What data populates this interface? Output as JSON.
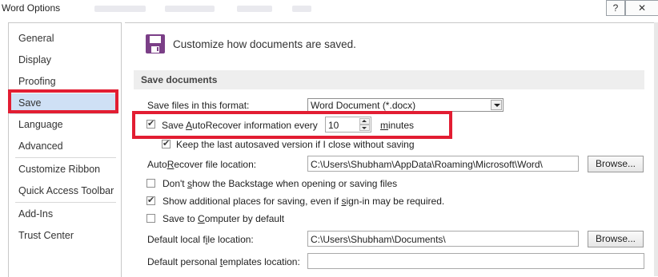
{
  "window": {
    "title": "Word Options",
    "help_label": "?",
    "close_label": "✕"
  },
  "nav": {
    "items": [
      {
        "label": "General"
      },
      {
        "label": "Display"
      },
      {
        "label": "Proofing"
      },
      {
        "label": "Save",
        "selected": true
      },
      {
        "label": "Language"
      },
      {
        "label": "Advanced"
      },
      {
        "label": "Customize Ribbon"
      },
      {
        "label": "Quick Access Toolbar"
      },
      {
        "label": "Add-Ins"
      },
      {
        "label": "Trust Center"
      }
    ]
  },
  "header": {
    "text": "Customize how documents are saved.",
    "icon": "floppy-disk-icon"
  },
  "section": {
    "title": "Save documents"
  },
  "format": {
    "label": "Save files in this format:",
    "value": "Word Document (*.docx)"
  },
  "autorecover": {
    "checked": true,
    "label_pre": "Save ",
    "label_ul": "A",
    "label_post": "utoRecover information every",
    "minutes_value": "10",
    "minutes_ul": "m",
    "minutes_post": "inutes"
  },
  "keep_last": {
    "checked": true,
    "label": "Keep the last autosaved version if I close without saving"
  },
  "autorecover_location": {
    "label_pre": "Auto",
    "label_ul": "R",
    "label_post": "ecover file location:",
    "value": "C:\\Users\\Shubham\\AppData\\Roaming\\Microsoft\\Word\\",
    "browse_label": "Browse..."
  },
  "dont_show_backstage": {
    "checked": false,
    "label_pre": "Don't ",
    "label_ul": "s",
    "label_post": "how the Backstage when opening or saving files"
  },
  "show_additional": {
    "checked": true,
    "label_pre": "Show additional places for saving, even if ",
    "label_ul": "s",
    "label_post": "ign-in may be required."
  },
  "save_to_computer": {
    "checked": false,
    "label_pre": "Save to ",
    "label_ul": "C",
    "label_post": "omputer by default"
  },
  "default_local": {
    "label_pre": "Default local f",
    "label_ul": "i",
    "label_post": "le location:",
    "value": "C:\\Users\\Shubham\\Documents\\",
    "browse_label": "Browse..."
  },
  "personal_templates": {
    "label_pre": "Default personal ",
    "label_ul": "t",
    "label_post": "emplates location:",
    "value": ""
  },
  "colors": {
    "highlight_red": "#e21d32",
    "selected_nav": "#cfe0f5",
    "section_bar": "#eeeeee"
  }
}
